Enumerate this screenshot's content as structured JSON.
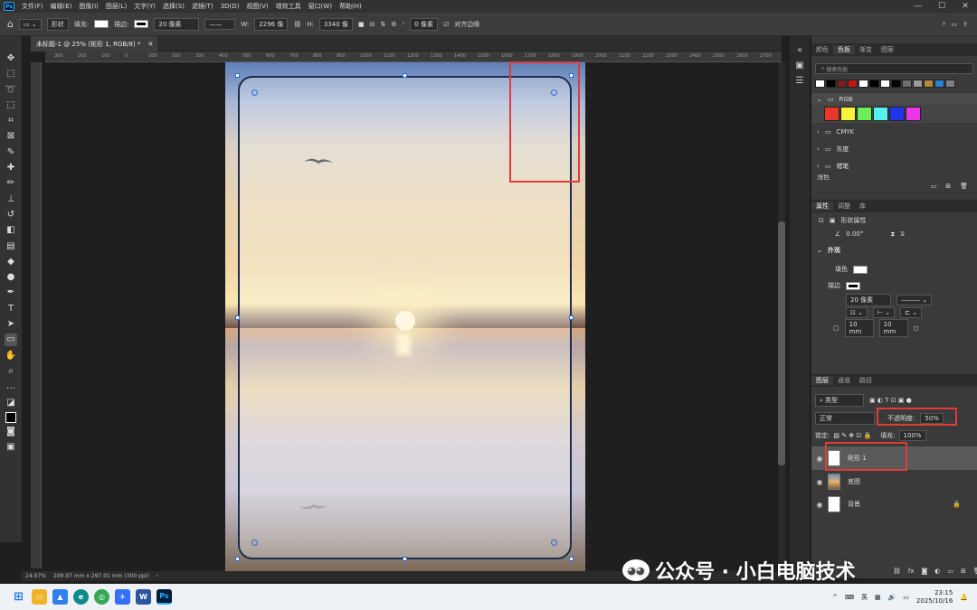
{
  "menu": {
    "logo": "Ps",
    "items": [
      "文件(F)",
      "编辑(E)",
      "图像(I)",
      "图层(L)",
      "文字(Y)",
      "选择(S)",
      "滤镜(T)",
      "3D(D)",
      "视图(V)",
      "增效工具",
      "窗口(W)",
      "帮助(H)"
    ],
    "window_controls": [
      "—",
      "☐",
      "✕"
    ]
  },
  "options": {
    "mode": "形状",
    "fill_label": "填充:",
    "stroke_label": "描边:",
    "stroke_width": "20 像素",
    "w_label": "W:",
    "w_value": "2296 像",
    "h_label": "H:",
    "h_value": "3340 像",
    "corner_value": "0 像素",
    "align_edges_label": "对齐边缘"
  },
  "document": {
    "tab_title": "未标题-1 @ 25% (矩形 1, RGB/8) *",
    "ruler_ticks": [
      "300",
      "200",
      "100",
      "0",
      "100",
      "200",
      "300",
      "400",
      "500",
      "600",
      "700",
      "800",
      "900",
      "1000",
      "1100",
      "1200",
      "1300",
      "1400",
      "1500",
      "1600",
      "1700",
      "1800",
      "1900",
      "2000",
      "2100",
      "2200",
      "2300",
      "2400",
      "2500",
      "2600",
      "2700"
    ]
  },
  "status": {
    "zoom": "24.97%",
    "doc_size": "209.97 mm x 297.01 mm (300 ppi)"
  },
  "swatches": {
    "tabs": [
      "颜色",
      "色板",
      "渐变",
      "图案"
    ],
    "active_tab": "色板",
    "search_placeholder": "搜索色板",
    "top_row_colors": [
      "#ffffff",
      "#000000",
      "#7a1f1f",
      "#c01515",
      "#ffffff",
      "#000000",
      "#ffffff",
      "#000000",
      "#6e6e6e",
      "#9a9a9a",
      "#b58a3c",
      "#2e7fd6",
      "#808080"
    ],
    "rgb_group": "RGB",
    "rgb_colors": [
      "#e8362b",
      "#f7f33a",
      "#6cf05a",
      "#59f1f0",
      "#1f35e8",
      "#e936e7"
    ],
    "groups": [
      "CMYK",
      "灰度",
      "蜡笔",
      "浅色"
    ]
  },
  "properties": {
    "tabs": [
      "属性",
      "调整",
      "库"
    ],
    "active_tab": "属性",
    "shape_props_label": "形状属性",
    "angle": "0.00°",
    "appearance_label": "外观",
    "fill_label": "填色",
    "stroke_label": "描边",
    "stroke_width": "20 像素",
    "corner_w": "10 mm",
    "corner_h": "10 mm"
  },
  "layers": {
    "tabs": [
      "图层",
      "通道",
      "路径"
    ],
    "active_tab": "图层",
    "filter_label": "类型",
    "blend_mode": "正常",
    "opacity_label": "不透明度:",
    "opacity_value": "50%",
    "lock_label": "锁定:",
    "fill_label": "填充:",
    "fill_value": "100%",
    "items": [
      {
        "name": "矩形 1",
        "selected": true
      },
      {
        "name": "底图",
        "selected": false
      },
      {
        "name": "背景",
        "selected": false
      }
    ]
  },
  "watermark": {
    "text": "公众号 · 小白电脑技术"
  },
  "taskbar": {
    "apps": [
      "start",
      "files",
      "photos",
      "edge",
      "chrome",
      "feishu",
      "word",
      "photoshop"
    ],
    "lang": "英",
    "time": "23:15",
    "date": "2025/10/16"
  },
  "colors": {
    "highlight_red": "#e03b3b",
    "selection_blue": "#2a6bd5"
  }
}
